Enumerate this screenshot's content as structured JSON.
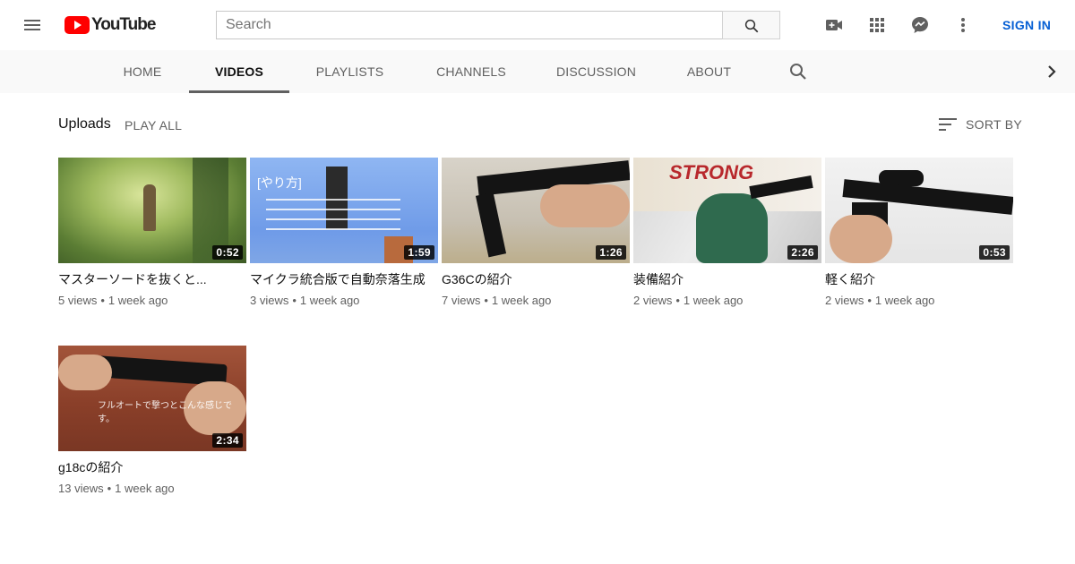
{
  "header": {
    "logo_text": "YouTube",
    "search_placeholder": "Search",
    "sign_in": "SIGN IN"
  },
  "tabs": [
    {
      "label": "HOME"
    },
    {
      "label": "VIDEOS",
      "active": true
    },
    {
      "label": "PLAYLISTS"
    },
    {
      "label": "CHANNELS"
    },
    {
      "label": "DISCUSSION"
    },
    {
      "label": "ABOUT"
    }
  ],
  "section": {
    "title": "Uploads",
    "play_all": "PLAY ALL",
    "sort_by": "SORT BY"
  },
  "videos": [
    {
      "title": "マスターソードを抜くと...",
      "views": "5 views",
      "age": "1 week ago",
      "duration": "0:52"
    },
    {
      "title": "マイクラ統合版で自動奈落生成",
      "views": "3 views",
      "age": "1 week ago",
      "duration": "1:59",
      "thumb_text": "[やり方]"
    },
    {
      "title": "G36Cの紹介",
      "views": "7 views",
      "age": "1 week ago",
      "duration": "1:26"
    },
    {
      "title": "装備紹介",
      "views": "2 views",
      "age": "1 week ago",
      "duration": "2:26",
      "thumb_text": "STRONG"
    },
    {
      "title": "軽く紹介",
      "views": "2 views",
      "age": "1 week ago",
      "duration": "0:53"
    },
    {
      "title": "g18cの紹介",
      "views": "13 views",
      "age": "1 week ago",
      "duration": "2:34",
      "thumb_text": "フルオートで撃つとこんな感じです。"
    }
  ],
  "colors": {
    "brand_red": "#ff0000",
    "link_blue": "#065fd4",
    "secondary_text": "#606060"
  },
  "icons": [
    "menu-icon",
    "youtube-logo-icon",
    "search-icon",
    "video-camera-plus-icon",
    "apps-grid-icon",
    "messages-icon",
    "more-vert-icon",
    "tab-search-icon",
    "chevron-right-icon",
    "sort-icon"
  ]
}
